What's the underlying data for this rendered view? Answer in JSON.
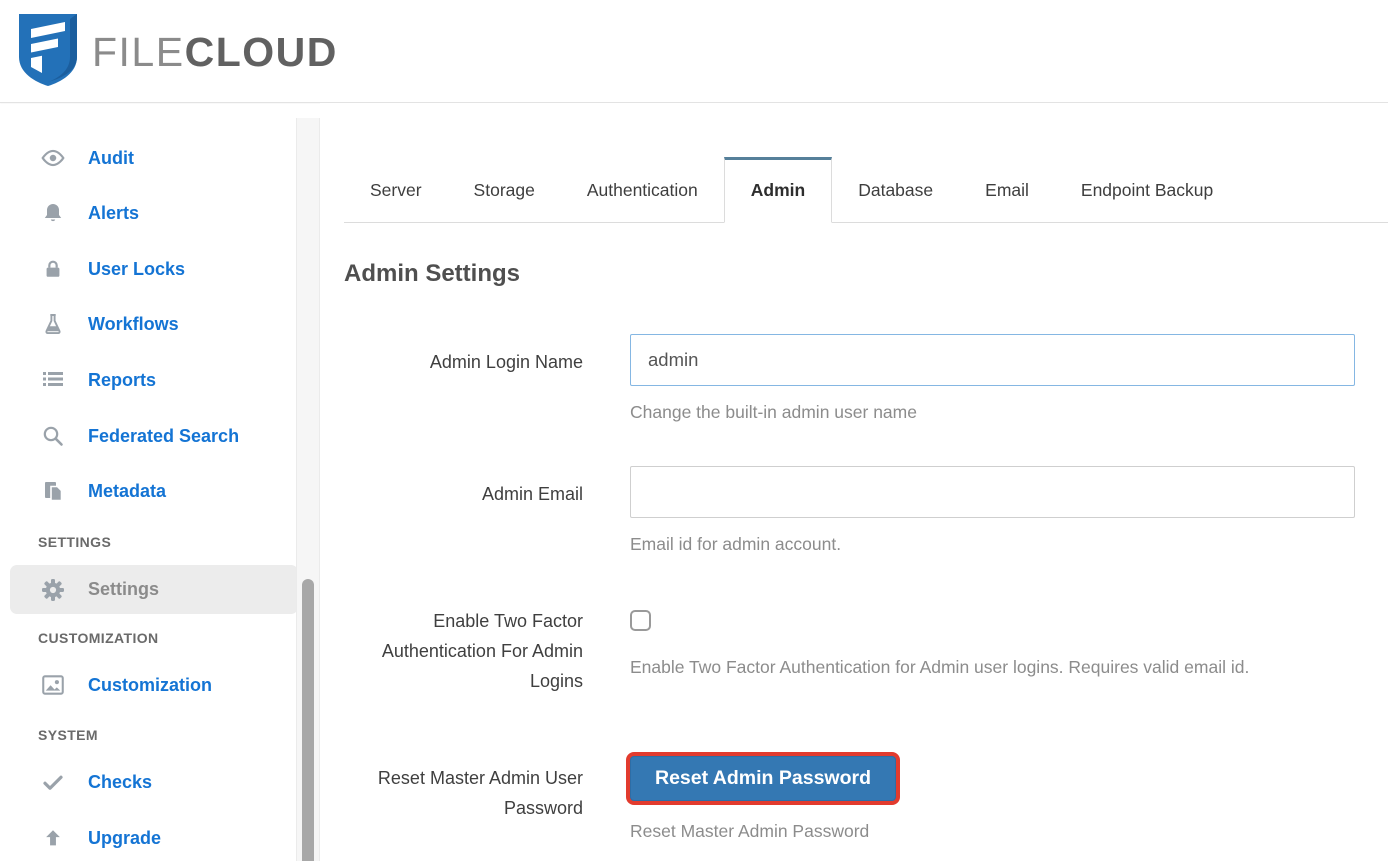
{
  "header": {
    "brand": {
      "file": "FILE",
      "cloud": "CLOUD"
    }
  },
  "sidebar": {
    "items": [
      {
        "label": "Audit",
        "icon": "eye-icon"
      },
      {
        "label": "Alerts",
        "icon": "bell-icon"
      },
      {
        "label": "User Locks",
        "icon": "lock-icon"
      },
      {
        "label": "Workflows",
        "icon": "flask-icon"
      },
      {
        "label": "Reports",
        "icon": "list-icon"
      },
      {
        "label": "Federated Search",
        "icon": "search-icon"
      },
      {
        "label": "Metadata",
        "icon": "documents-icon"
      },
      {
        "label": "Settings",
        "icon": "gear-icon",
        "active": true
      },
      {
        "label": "Customization",
        "icon": "image-icon"
      },
      {
        "label": "Checks",
        "icon": "check-icon"
      },
      {
        "label": "Upgrade",
        "icon": "arrow-up-icon"
      }
    ],
    "section_headers": [
      "SETTINGS",
      "CUSTOMIZATION",
      "SYSTEM"
    ]
  },
  "tabs": {
    "items": [
      "Server",
      "Storage",
      "Authentication",
      "Admin",
      "Database",
      "Email",
      "Endpoint Backup"
    ],
    "active": "Admin"
  },
  "main": {
    "title": "Admin Settings",
    "admin_login": {
      "label": "Admin Login Name",
      "value": "admin",
      "help": "Change the built-in admin user name"
    },
    "admin_email": {
      "label": "Admin Email",
      "value": "",
      "help": "Email id for admin account."
    },
    "two_factor": {
      "label": "Enable Two Factor Authentication For Admin Logins",
      "checked": false,
      "help": "Enable Two Factor Authentication for Admin user logins. Requires valid email id."
    },
    "reset_admin": {
      "label": "Reset Master Admin User Password",
      "button_label": "Reset Admin Password",
      "help": "Reset Master Admin Password"
    }
  },
  "colors": {
    "sidebar_link_blue": "#1474d4",
    "active_tab_accent": "#56809a",
    "button_blue": "#3478b3",
    "annotation_red": "#e23b2e",
    "focused_input_border": "#85b7e3",
    "icon_gray": "#9aa2aa"
  }
}
